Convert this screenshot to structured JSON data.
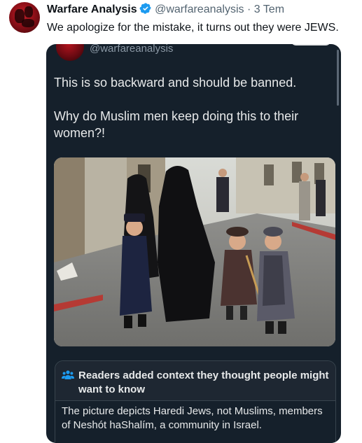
{
  "tweet": {
    "author_name": "Warfare Analysis",
    "handle": "@warfareanalysis",
    "separator": "·",
    "time": "3 Tem",
    "text": "We apologize for the mistake, it turns out they were JEWS.",
    "verified_icon": "verified-badge-icon",
    "verified_color": "#1d9bf0"
  },
  "quoted": {
    "handle": "@warfareanalysis",
    "paragraphs": [
      "This is so backward and should be banned.",
      "Why do Muslim men keep doing this to their women?!"
    ],
    "background": "#15202b"
  },
  "community_note": {
    "icon": "people-group-icon",
    "icon_color": "#1d9bf0",
    "title": "Readers added context they thought people might want to know",
    "body": "The picture depicts Haredi Jews, not Muslims, members of Neshót haShalím, a community in Israel."
  }
}
